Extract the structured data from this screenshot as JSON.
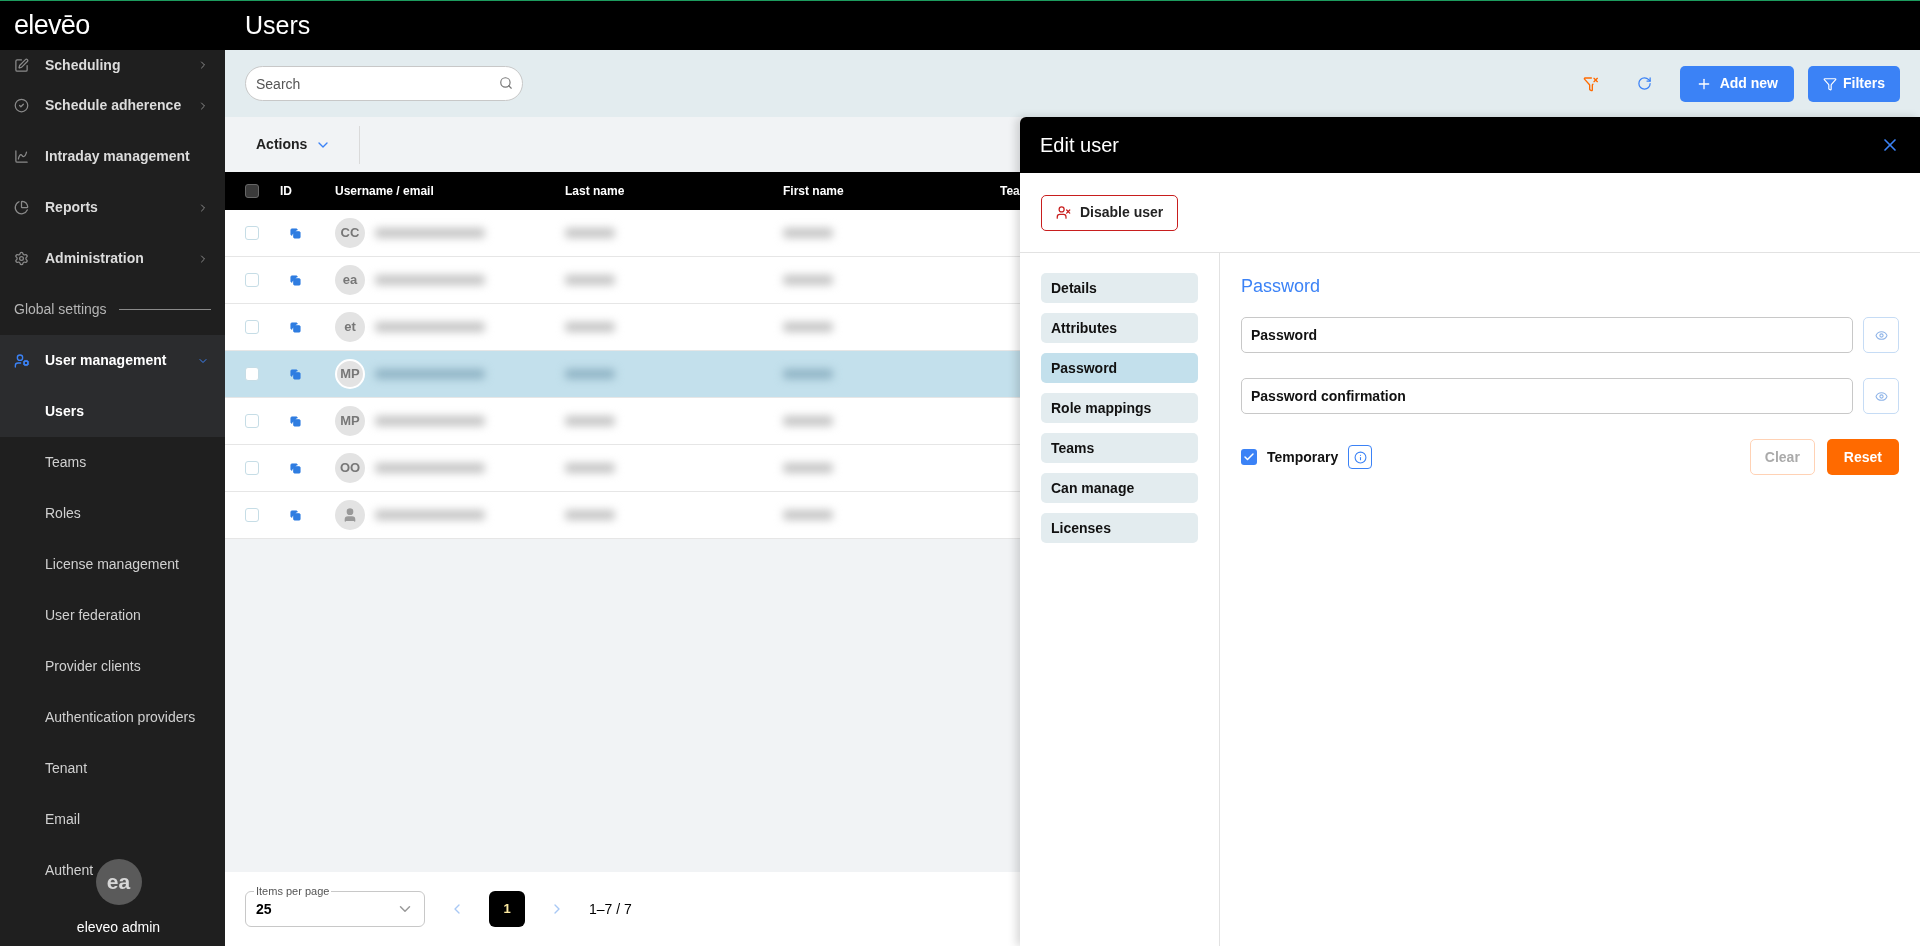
{
  "app": {
    "logo": "elevēo",
    "page_title": "Users"
  },
  "sidebar": {
    "items": [
      {
        "label": "Scheduling",
        "expandable": true
      },
      {
        "label": "Schedule adherence",
        "expandable": true
      },
      {
        "label": "Intraday management",
        "expandable": false
      },
      {
        "label": "Reports",
        "expandable": true
      },
      {
        "label": "Administration",
        "expandable": true
      }
    ],
    "section": "Global settings",
    "group": {
      "label": "User management",
      "expanded": true,
      "children": [
        {
          "label": "Users",
          "selected": true
        },
        {
          "label": "Teams",
          "selected": false
        },
        {
          "label": "Roles",
          "selected": false
        },
        {
          "label": "License management",
          "selected": false
        },
        {
          "label": "User federation",
          "selected": false
        },
        {
          "label": "Provider clients",
          "selected": false
        },
        {
          "label": "Authentication providers",
          "selected": false
        },
        {
          "label": "Tenant",
          "selected": false
        },
        {
          "label": "Email",
          "selected": false
        },
        {
          "label": "Authent",
          "selected": false
        }
      ]
    },
    "user": {
      "initials": "ea",
      "name": "eleveo admin"
    }
  },
  "toolbar": {
    "search_placeholder": "Search",
    "add_button": "Add new",
    "filters_button": "Filters"
  },
  "actions": "Actions",
  "table": {
    "select_all_checked": false,
    "columns": [
      "ID",
      "Username / email",
      "Last name",
      "First name",
      "Tea"
    ],
    "rows": [
      {
        "avatar": "CC",
        "kind": "initials",
        "selected": false
      },
      {
        "avatar": "ea",
        "kind": "initials",
        "selected": false
      },
      {
        "avatar": "et",
        "kind": "initials",
        "selected": false
      },
      {
        "avatar": "MP",
        "kind": "initials",
        "selected": true
      },
      {
        "avatar": "MP",
        "kind": "initials",
        "selected": false
      },
      {
        "avatar": "OO",
        "kind": "initials",
        "selected": false
      },
      {
        "kind": "silhouette",
        "selected": false
      }
    ]
  },
  "pagination": {
    "items_per_page_label": "Items per page",
    "items_per_page": "25",
    "pages": [
      {
        "label": "1",
        "selected": true
      }
    ],
    "range": "1–7 / 7"
  },
  "edit_panel": {
    "title": "Edit user",
    "disable_button": "Disable user",
    "tabs": [
      {
        "label": "Details",
        "selected": false
      },
      {
        "label": "Attributes",
        "selected": false
      },
      {
        "label": "Password",
        "selected": true
      },
      {
        "label": "Role mappings",
        "selected": false
      },
      {
        "label": "Teams",
        "selected": false
      },
      {
        "label": "Can manage",
        "selected": false
      },
      {
        "label": "Licenses",
        "selected": false
      }
    ],
    "section_title": "Password",
    "fields": [
      {
        "placeholder": "Password"
      },
      {
        "placeholder": "Password confirmation"
      }
    ],
    "temporary": {
      "label": "Temporary",
      "checked": true
    },
    "buttons": [
      {
        "label": "Clear",
        "kind": "secondary",
        "disabled": true
      },
      {
        "label": "Reset",
        "kind": "primary",
        "disabled": false
      }
    ]
  }
}
